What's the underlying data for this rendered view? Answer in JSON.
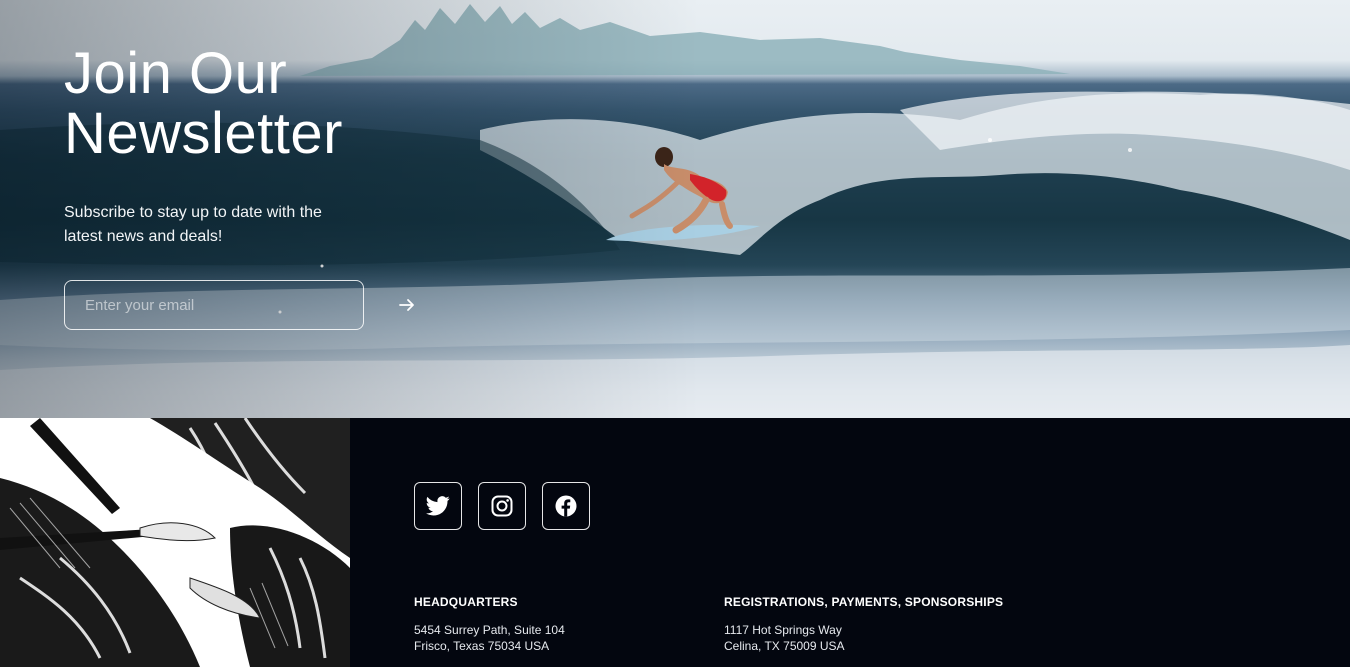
{
  "newsletter": {
    "title_line1": "Join Our",
    "title_line2": "Newsletter",
    "subtitle": "Subscribe to stay up to date with the latest news and deals!",
    "email_placeholder": "Enter your email",
    "submit_icon": "arrow-right-icon"
  },
  "social": [
    {
      "icon": "twitter-icon"
    },
    {
      "icon": "instagram-icon"
    },
    {
      "icon": "facebook-icon"
    }
  ],
  "footer": {
    "headquarters": {
      "heading": "HEADQUARTERS",
      "line1": "5454 Surrey Path, Suite 104",
      "line2": "Frisco, Texas 75034 USA"
    },
    "registrations": {
      "heading": "REGISTRATIONS, PAYMENTS, SPONSORSHIPS",
      "line1": "1117 Hot Springs Way",
      "line2": "Celina, TX 75009 USA"
    }
  },
  "colors": {
    "footer_bg": "#03060f",
    "ocean_dark": "#173644",
    "sky": "#e9eff3",
    "swimsuit": "#d2232a"
  }
}
